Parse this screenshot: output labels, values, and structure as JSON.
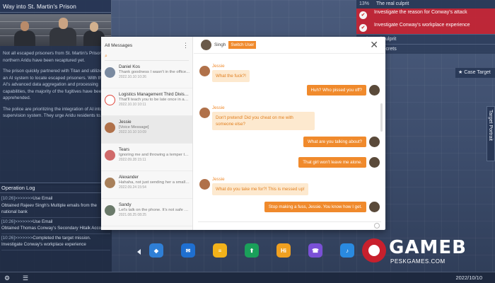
{
  "news": {
    "title": "Way into St. Martin's Prison",
    "paragraphs": [
      "Not all escaped prisoners from St. Martin's Prison in northern Aridu have been recaptured yet.",
      "The prison quickly partnered with Titan and utilized an AI system to locate escaped prisoners. With the AI's advanced data aggregation and processing capabilities, the majority of the fugitives have been apprehended.",
      "The police are prioritizing the integration of AI into supervision system. They urge Aridu residents to..."
    ]
  },
  "oplog": {
    "title": "Operation Log",
    "entries": [
      {
        "ts": "[10:26]>>>>>>>",
        "text": "Use Email"
      },
      {
        "ts": "",
        "text": "Obtained Rajeev Singh's Multiple emails from the national bank"
      },
      {
        "ts": "[10:26]>>>>>>>",
        "text": "Use Email"
      },
      {
        "ts": "",
        "text": "Obtained Thomas Conway's Secondary Hitalk Account"
      },
      {
        "ts": "[10:26]>>>>>>>",
        "text": "Completed the target mission."
      },
      {
        "ts": "",
        "text": "Investigate Conway's workplace experience"
      }
    ]
  },
  "tasks": {
    "progress": "13%",
    "header": "The real culprit",
    "items": [
      "Investigate the reason for Conway's attack",
      "Investigate Conway's workplace experience"
    ],
    "sub1": "The real culprit",
    "sub2": "Hidden secrets",
    "case_target": "Case Target",
    "side_tab": "Target Portrait"
  },
  "messenger": {
    "title": "All Messages",
    "menu_icon": "⋮",
    "search_icon": "⌕",
    "current_user": "Singh",
    "switch_label": "Switch User",
    "close_icon": "✕",
    "contacts": [
      {
        "name": "Daniel Kos",
        "preview": "Thank goodness I wasn't in the office...",
        "date": "2022.10.10 10:26",
        "color": "#7a8aa0"
      },
      {
        "name": "Logistics Management Third Division",
        "preview": "That'll teach you to be late once in a while",
        "date": "2022.10.10 10:11",
        "color": "#e0453a"
      },
      {
        "name": "Jessie",
        "preview": "[Voice Message]",
        "date": "2022.10.10 10:09",
        "color": "#b0714a"
      },
      {
        "name": "Tears",
        "preview": "Ignoring me and throwing a temper tantrum...",
        "date": "2022.09.28 15:11",
        "color": "#d06a6a"
      },
      {
        "name": "Alexander",
        "preview": "Hahaha, not just sending her a small gift...",
        "date": "2022.09.24 15:54",
        "color": "#a8805a"
      },
      {
        "name": "Sandy",
        "preview": "Let's talk on the phone. It's not safe here.",
        "date": "2021.08.25 08:25",
        "color": "#6a7a6a"
      }
    ],
    "messages": [
      {
        "side": "left",
        "name": "Jessie",
        "text": "What the fuck?!"
      },
      {
        "side": "right",
        "text": "Huh? Who pissed you off?"
      },
      {
        "side": "left",
        "name": "Jessie",
        "text": "Don't pretend! Did you cheat on me with someone else?"
      },
      {
        "side": "right",
        "text": "What are you talking about?"
      },
      {
        "side": "right",
        "text": "That girl won't leave me alone."
      },
      {
        "side": "left",
        "name": "Jessie",
        "text": "What do you take me for?! This is messed up!"
      },
      {
        "side": "right",
        "text": "Stop making a fuss, Jessie. You know how I get."
      }
    ]
  },
  "dock": {
    "apps": [
      {
        "name": "browser",
        "glyph": "◆",
        "color": "#2f7fd6"
      },
      {
        "name": "mail",
        "glyph": "✉",
        "color": "#1f6fd0"
      },
      {
        "name": "notes",
        "glyph": "≡",
        "color": "#f2b21a"
      },
      {
        "name": "maps",
        "glyph": "⬆",
        "color": "#1aa05a"
      },
      {
        "name": "hitalk",
        "glyph": "Hi",
        "color": "#f0a020"
      },
      {
        "name": "phone",
        "glyph": "☎",
        "color": "#7a50d6"
      },
      {
        "name": "music",
        "glyph": "♪",
        "color": "#2a8ae0"
      }
    ]
  },
  "watermark": {
    "main": "GAMEB",
    "sub": "PESKGAMES.COM"
  },
  "bottom": {
    "date": "2022/10/10",
    "gear_icon": "⚙",
    "list_icon": "☰"
  }
}
